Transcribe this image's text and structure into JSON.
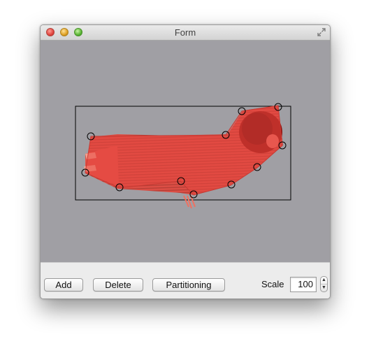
{
  "window": {
    "title": "Form"
  },
  "toolbar": {
    "add_label": "Add",
    "delete_label": "Delete",
    "partitioning_label": "Partitioning",
    "scale_label": "Scale",
    "scale_value": "100"
  },
  "colors": {
    "canvas_background": "#a09fa4",
    "mesh_fill": "#e8473f",
    "accent_dark": "#a3120f"
  },
  "icons": {
    "close": "close-icon",
    "minimize": "minimize-icon",
    "zoom": "zoom-icon",
    "fullscreen": "fullscreen-icon",
    "stepper_up": "chevron-up-icon",
    "stepper_down": "chevron-down-icon"
  }
}
